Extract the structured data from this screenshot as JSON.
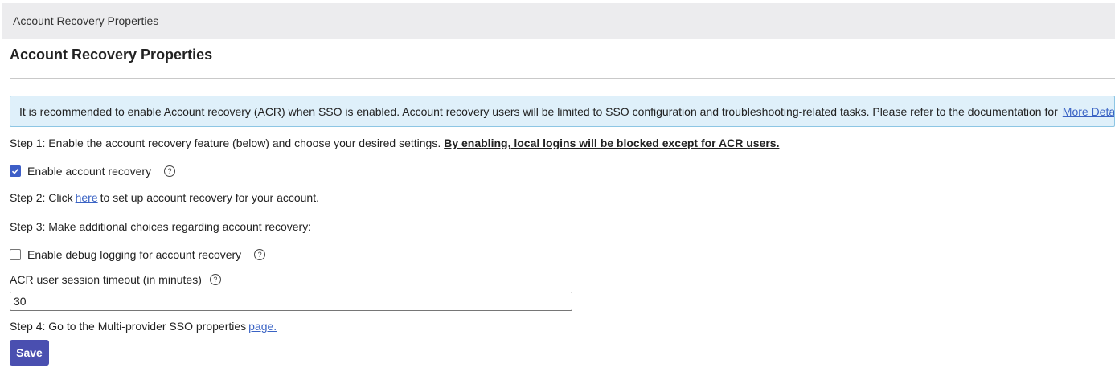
{
  "header": {
    "breadcrumb": "Account Recovery Properties"
  },
  "page": {
    "title": "Account Recovery Properties"
  },
  "info_banner": {
    "text": "It is recommended to enable Account recovery (ACR) when SSO is enabled. Account recovery users will be limited to SSO configuration and troubleshooting-related tasks. Please refer to the documentation for",
    "link_label": "More Details."
  },
  "step1": {
    "text": "Step 1: Enable the account recovery feature (below) and choose your desired settings.",
    "warning": "By enabling, local logins will be blocked except for ACR users."
  },
  "enable_acr": {
    "label": "Enable account recovery",
    "checked": true
  },
  "step2": {
    "prefix": "Step 2: Click",
    "link_label": "here",
    "suffix": "to set up account recovery for your account."
  },
  "step3": {
    "text": "Step 3: Make additional choices regarding account recovery:"
  },
  "debug_logging": {
    "label": "Enable debug logging for account recovery",
    "checked": false
  },
  "session_timeout": {
    "label": "ACR user session timeout (in minutes)",
    "value": "30"
  },
  "step4": {
    "text": "Step 4: Go to the Multi-provider SSO properties",
    "link_label": "page."
  },
  "help_icon_glyph": "?",
  "actions": {
    "save_label": "Save"
  },
  "colors": {
    "accent": "#4a4fb0",
    "checkbox_checked": "#3d5ec7",
    "link": "#3a63c4",
    "banner_bg": "#dff0fa",
    "banner_border": "#8dc6e4"
  }
}
